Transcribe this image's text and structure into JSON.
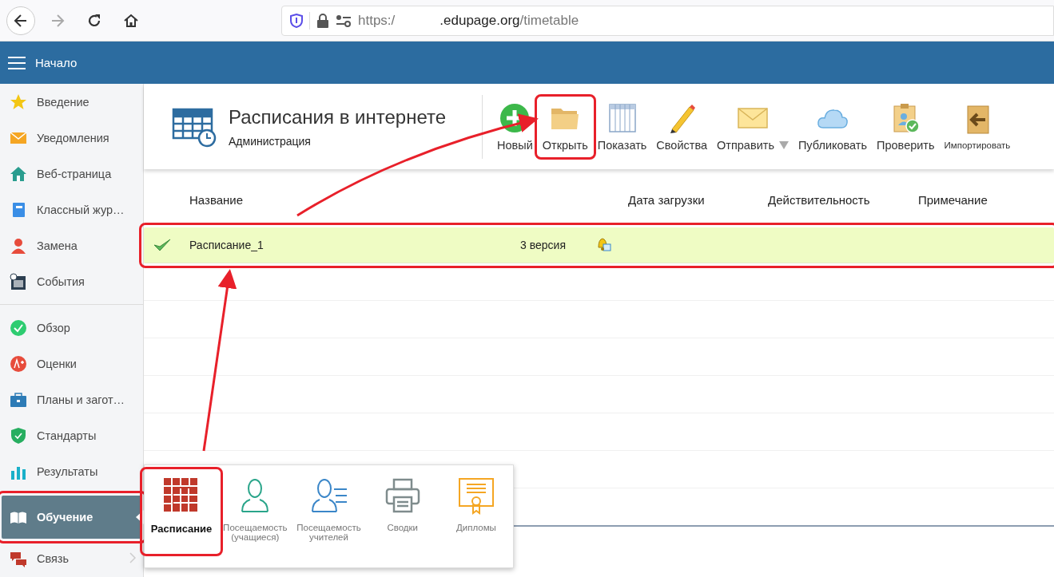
{
  "browser": {
    "url": {
      "prefix": "https:/",
      "host": ".edupage.org",
      "path": "/timetable"
    }
  },
  "header": {
    "title": "Начало"
  },
  "sidebar": {
    "groups": [
      [
        {
          "label": "Введение",
          "selected": false,
          "has_submenu": false
        },
        {
          "label": "Уведомления",
          "selected": false,
          "has_submenu": false
        },
        {
          "label": "Веб-страница",
          "selected": false,
          "has_submenu": false
        },
        {
          "label": "Классный жур…",
          "selected": false,
          "has_submenu": false
        },
        {
          "label": "Замена",
          "selected": false,
          "has_submenu": false
        },
        {
          "label": "События",
          "selected": false,
          "has_submenu": false
        }
      ],
      [
        {
          "label": "Обзор",
          "selected": false,
          "has_submenu": false
        },
        {
          "label": "Оценки",
          "selected": false,
          "has_submenu": false
        },
        {
          "label": "Планы и загот…",
          "selected": false,
          "has_submenu": false
        },
        {
          "label": "Стандарты",
          "selected": false,
          "has_submenu": false
        },
        {
          "label": "Результаты",
          "selected": false,
          "has_submenu": false
        },
        {
          "label": "Обучение",
          "selected": true,
          "has_submenu": true,
          "highlighted": true
        },
        {
          "label": "Связь",
          "selected": false,
          "has_submenu": true
        }
      ]
    ]
  },
  "toolbar": {
    "title": "Расписания в интернете",
    "subtitle": "Администрация",
    "buttons": [
      {
        "label": "Новый"
      },
      {
        "label": "Открыть",
        "highlighted": true
      },
      {
        "label": "Показать"
      },
      {
        "label": "Свойства"
      },
      {
        "label": "Отправить",
        "has_dropdown": true
      },
      {
        "label": "Публиковать"
      },
      {
        "label": "Проверить"
      },
      {
        "label": "Импортировать",
        "compact": true
      }
    ]
  },
  "table": {
    "columns": [
      "Название",
      "Дата загрузки",
      "Действительность",
      "Примечание"
    ],
    "rows": [
      {
        "checked": true,
        "name": "Расписание_1",
        "version": "3 версия",
        "highlighted": true
      }
    ]
  },
  "popup_menu": {
    "items": [
      {
        "label": "Расписание",
        "selected": true,
        "highlighted": true
      },
      {
        "label": "Посещаемость (учащиеся)",
        "selected": false
      },
      {
        "label": "Посещаемость учителей",
        "selected": false
      },
      {
        "label": "Сводки",
        "selected": false
      },
      {
        "label": "Дипломы",
        "selected": false
      }
    ]
  }
}
